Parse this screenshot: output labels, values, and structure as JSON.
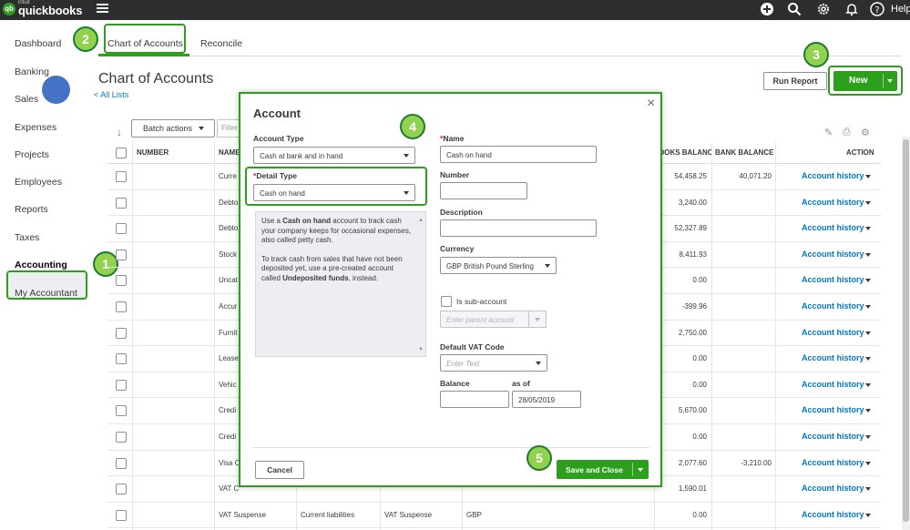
{
  "app": {
    "logo_mark": "qb",
    "brand_small": "intuit",
    "brand": "quickbooks",
    "help_label": "Help"
  },
  "topbar_icons": [
    "plus-icon",
    "search-icon",
    "gear-icon",
    "bell-icon",
    "help-icon"
  ],
  "sidebar": {
    "items": [
      {
        "label": "Dashboard"
      },
      {
        "label": "Banking"
      },
      {
        "label": "Sales"
      },
      {
        "label": "Expenses"
      },
      {
        "label": "Projects"
      },
      {
        "label": "Employees"
      },
      {
        "label": "Reports"
      },
      {
        "label": "Taxes"
      },
      {
        "label": "Accounting"
      },
      {
        "label": "My Accountant"
      }
    ]
  },
  "tabs": [
    {
      "label": "Chart of Accounts"
    },
    {
      "label": "Reconcile"
    }
  ],
  "page": {
    "title": "Chart of Accounts",
    "all_lists": "< All Lists",
    "run_report": "Run Report",
    "new_label": "New",
    "batch_actions": "Batch actions",
    "filter_placeholder": "Filter"
  },
  "badges": [
    "1",
    "2",
    "3",
    "4",
    "5"
  ],
  "table": {
    "headers": [
      "NUMBER",
      "NAME",
      "OOKS BALANC",
      "BANK BALANCE",
      "ACTION"
    ],
    "action_label": "Account history",
    "rows": [
      {
        "name": "Curre",
        "type": "",
        "detail": "",
        "currency": "",
        "qb_balance": "54,458.25",
        "bank_balance": "40,071.20"
      },
      {
        "name": "Debto",
        "type": "",
        "detail": "",
        "currency": "",
        "qb_balance": "3,240.00",
        "bank_balance": ""
      },
      {
        "name": "Debto",
        "type": "",
        "detail": "",
        "currency": "",
        "qb_balance": "52,327.89",
        "bank_balance": ""
      },
      {
        "name": "Stock",
        "type": "",
        "detail": "",
        "currency": "",
        "qb_balance": "8,411.93",
        "bank_balance": ""
      },
      {
        "name": "Uncat",
        "type": "",
        "detail": "",
        "currency": "",
        "qb_balance": "0.00",
        "bank_balance": ""
      },
      {
        "name": "Accur",
        "type": "",
        "detail": "",
        "currency": "",
        "qb_balance": "-399.96",
        "bank_balance": ""
      },
      {
        "name": "Furnit",
        "type": "",
        "detail": "",
        "currency": "",
        "qb_balance": "2,750.00",
        "bank_balance": ""
      },
      {
        "name": "Lease",
        "type": "",
        "detail": "",
        "currency": "",
        "qb_balance": "0.00",
        "bank_balance": ""
      },
      {
        "name": "Vehic",
        "type": "",
        "detail": "",
        "currency": "",
        "qb_balance": "0.00",
        "bank_balance": ""
      },
      {
        "name": "Credi",
        "type": "",
        "detail": "",
        "currency": "",
        "qb_balance": "5,670.00",
        "bank_balance": ""
      },
      {
        "name": "Credi",
        "type": "",
        "detail": "",
        "currency": "",
        "qb_balance": "0.00",
        "bank_balance": ""
      },
      {
        "name": "Visa C",
        "type": "",
        "detail": "",
        "currency": "",
        "qb_balance": "2,077.60",
        "bank_balance": "-3,210.00"
      },
      {
        "name": "VAT C",
        "type": "",
        "detail": "",
        "currency": "",
        "qb_balance": "1,590.01",
        "bank_balance": ""
      },
      {
        "name": "VAT Suspense",
        "type": "Current liabilities",
        "detail": "VAT Suspense",
        "currency": "GBP",
        "qb_balance": "0.00",
        "bank_balance": ""
      },
      {
        "name": "",
        "type": "",
        "detail": "",
        "currency": "",
        "qb_balance": "",
        "bank_balance": ""
      }
    ]
  },
  "modal": {
    "title": "Account",
    "close": "×",
    "account_type_label": "Account Type",
    "account_type_value": "Cash at bank and in hand",
    "detail_type_req": "*",
    "detail_type_label": "Detail Type",
    "detail_type_value": "Cash on hand",
    "description_p1_pre": "Use a ",
    "description_p1_bold": "Cash on hand",
    "description_p1_post": " account to track cash your company keeps for occasional expenses, also called petty cash.",
    "description_p2_pre": "To track cash from sales that have not been deposited yet, use a pre-created account called ",
    "description_p2_bold": "Undeposited funds",
    "description_p2_post": ", instead.",
    "name_req": "*",
    "name_label": "Name",
    "name_value": "Cash on hand",
    "number_label": "Number",
    "number_value": "",
    "description_label": "Description",
    "description_value": "",
    "currency_label": "Currency",
    "currency_value": "GBP British Pound Sterling",
    "subaccount_label": "Is sub-account",
    "parent_placeholder": "Enter parent account",
    "vat_label": "Default VAT Code",
    "vat_placeholder": "Enter Text",
    "balance_label": "Balance",
    "balance_value": "",
    "asof_label": "as of",
    "asof_value": "28/05/2019",
    "cancel": "Cancel",
    "save_close": "Save and Close"
  },
  "colors": {
    "accent": "#2ca01c",
    "link": "#0077c5",
    "topbar": "#2d2e30",
    "badge": "#92d050"
  }
}
